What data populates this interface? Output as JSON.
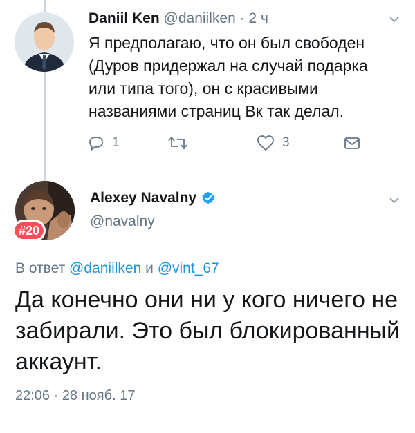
{
  "tweets": {
    "parent": {
      "name": "Daniil Ken",
      "handle": "@daniilken",
      "separator": "·",
      "time": "2 ч",
      "text": "Я предполагаю, что он был свободен (Дуров придержал на случай подарка или типа того), он с красивыми названиями страниц Вк так делал.",
      "actions": {
        "reply_count": "1",
        "retweet_count": "",
        "like_count": "3"
      }
    },
    "main": {
      "name": "Alexey Navalny",
      "handle": "@navalny",
      "verified": true,
      "avatar_badge": "#20",
      "reply_prefix": "В ответ",
      "reply_user1": "@daniilken",
      "reply_and": "и",
      "reply_user2": "@vint_67",
      "text": "Да конечно они ни у кого ничего не забирали. Это был блокированный аккаунт.",
      "timestamp": "22:06 · 28 нояб. 17"
    }
  },
  "colors": {
    "link": "#1b95e0",
    "muted": "#657786",
    "verified": "#1da1f2",
    "badge": "#ff4d5a"
  }
}
